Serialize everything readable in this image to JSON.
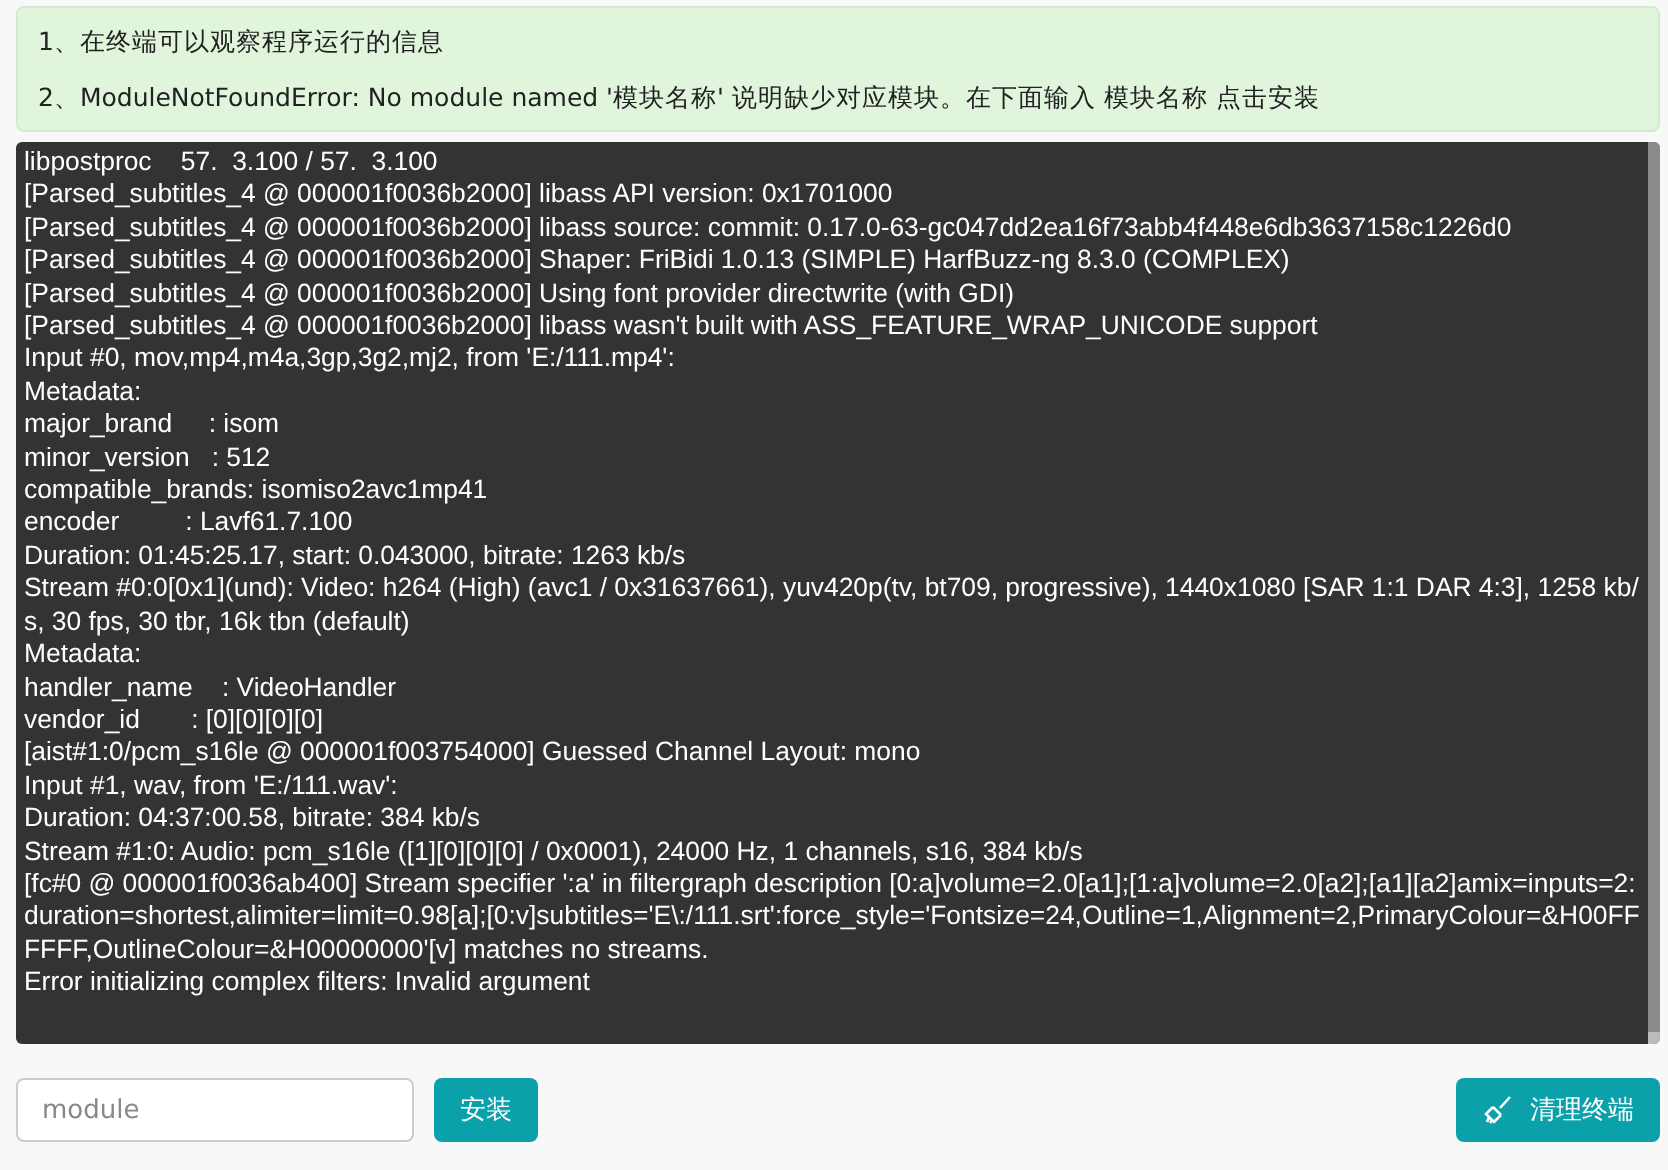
{
  "notice": {
    "items": [
      "1、在终端可以观察程序运行的信息",
      "2、ModuleNotFoundError: No module named '模块名称' 说明缺少对应模块。在下面输入 模块名称 点击安装"
    ]
  },
  "terminal": {
    "lines": [
      "libpostproc    57.  3.100 / 57.  3.100",
      "[Parsed_subtitles_4 @ 000001f0036b2000] libass API version: 0x1701000",
      "[Parsed_subtitles_4 @ 000001f0036b2000] libass source: commit: 0.17.0-63-gc047dd2ea16f73abb4f448e6db3637158c1226d0",
      "[Parsed_subtitles_4 @ 000001f0036b2000] Shaper: FriBidi 1.0.13 (SIMPLE) HarfBuzz-ng 8.3.0 (COMPLEX)",
      "[Parsed_subtitles_4 @ 000001f0036b2000] Using font provider directwrite (with GDI)",
      "[Parsed_subtitles_4 @ 000001f0036b2000] libass wasn't built with ASS_FEATURE_WRAP_UNICODE support",
      "Input #0, mov,mp4,m4a,3gp,3g2,mj2, from 'E:/111.mp4':",
      "Metadata:",
      "major_brand     : isom",
      "minor_version   : 512",
      "compatible_brands: isomiso2avc1mp41",
      "encoder         : Lavf61.7.100",
      "Duration: 01:45:25.17, start: 0.043000, bitrate: 1263 kb/s",
      "Stream #0:0[0x1](und): Video: h264 (High) (avc1 / 0x31637661), yuv420p(tv, bt709, progressive), 1440x1080 [SAR 1:1 DAR 4:3], 1258 kb/s, 30 fps, 30 tbr, 16k tbn (default)",
      "Metadata:",
      "handler_name    : VideoHandler",
      "vendor_id       : [0][0][0][0]",
      "[aist#1:0/pcm_s16le @ 000001f003754000] Guessed Channel Layout: mono",
      "Input #1, wav, from 'E:/111.wav':",
      "Duration: 04:37:00.58, bitrate: 384 kb/s",
      "Stream #1:0: Audio: pcm_s16le ([1][0][0][0] / 0x0001), 24000 Hz, 1 channels, s16, 384 kb/s",
      "[fc#0 @ 000001f0036ab400] Stream specifier ':a' in filtergraph description [0:a]volume=2.0[a1];[1:a]volume=2.0[a2];[a1][a2]amix=inputs=2:duration=shortest,alimiter=limit=0.98[a];[0:v]subtitles='E\\:/111.srt':force_style='Fontsize=24,Outline=1,Alignment=2,PrimaryColour=&H00FFFFFF,OutlineColour=&H00000000'[v] matches no streams.",
      "Error initializing complex filters: Invalid argument"
    ]
  },
  "install": {
    "placeholder": "module",
    "button": "安装"
  },
  "clear_button": "清理终端"
}
